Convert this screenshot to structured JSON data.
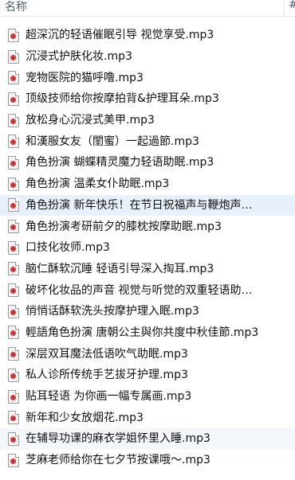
{
  "header": {
    "name_column": "名称",
    "next_column": "#"
  },
  "files": [
    "超深沉的轻语催眠引导 视觉享受.mp3",
    "沉浸式护肤化妆.mp3",
    "宠物医院的猫呼噜.mp3",
    "顶级技师给你按摩拍背&护理耳朵.mp3",
    "放松身心沉浸式美甲.mp3",
    "和漢服女友（閨蜜）一起過節.mp3",
    "角色扮演 蝴蝶精灵魔力轻语助眠.mp3",
    "角色扮演 温柔女仆助眠.mp3",
    "角色扮演 新年快乐！在节日祝福声与鞭炮声…",
    "角色扮演考研前夕的膝枕按摩助眠.mp3",
    "口技化妆师.mp3",
    "脑仁酥软沉睡 轻语引导深入掏耳.mp3",
    "破坏化妆品的声音 视觉与听觉的双重轻语助…",
    "悄悄话酥软洗头按摩护理入眠.mp3",
    "輕語角色扮演 唐朝公主與你共度中秋佳節.mp3",
    "深层双耳魔法低语吹气助眠.mp3",
    "私人诊所传统手艺拔牙护理.mp3",
    "贴耳轻语 为你画一幅专属画.mp3",
    "新年和少女放烟花.mp3",
    "在辅导功课的麻衣学姐怀里入睡.mp3",
    "芝麻老师给你在七夕节按课哦～.mp3"
  ],
  "selected_index": 8,
  "hover_index": 19,
  "colors": {
    "selected_bg": "#e8f0fb",
    "file_icon": "mp3-audio-file-icon"
  }
}
